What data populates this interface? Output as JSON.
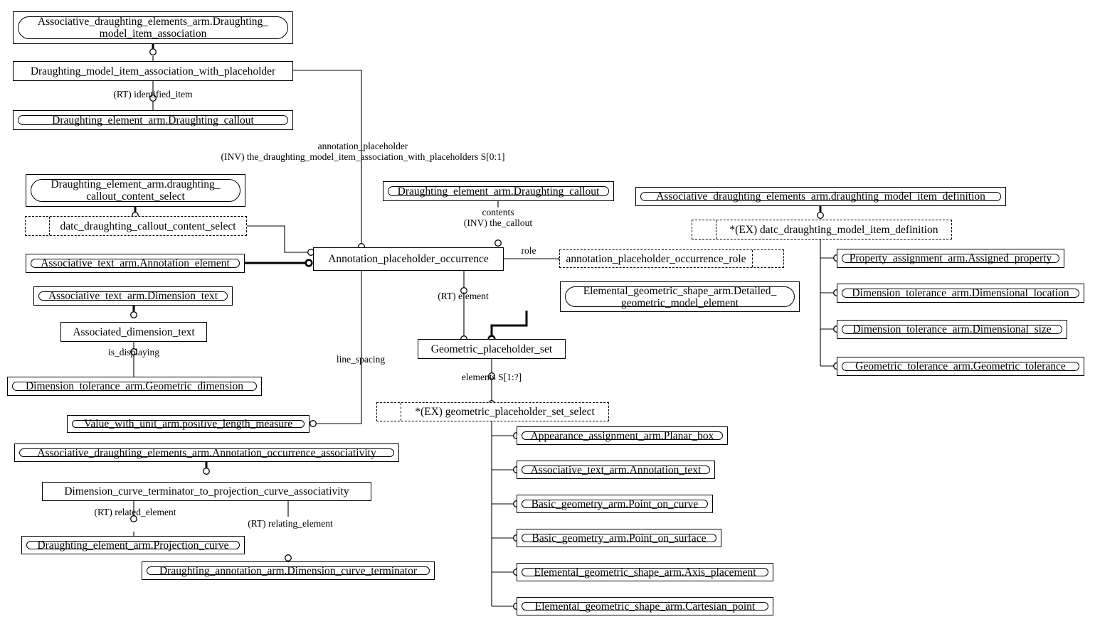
{
  "diagram": {
    "title": "EXPRESS-G entity-relationship diagram",
    "stroke_color": "#000000",
    "background_color": "#ffffff"
  },
  "entities": [
    {
      "id": "e1",
      "label": "Associative_draughting_elements_arm.Draughting_\nmodel_item_association",
      "style": "rounded"
    },
    {
      "id": "e2",
      "label": "Draughting_model_item_association_with_placeholder",
      "style": "plain"
    },
    {
      "id": "e3",
      "label": "Draughting_element_arm.Draughting_callout",
      "style": "rounded"
    },
    {
      "id": "e4",
      "label": "Draughting_element_arm.draughting_\ncallout_content_select",
      "style": "rounded"
    },
    {
      "id": "e5",
      "label": "Draughting_element_arm.Draughting_callout",
      "style": "rounded"
    },
    {
      "id": "e6",
      "label": "Associative_draughting_elements_arm.draughting_model_item_definition",
      "style": "rounded"
    },
    {
      "id": "e7",
      "label": "Associative_text_arm.Annotation_element",
      "style": "rounded"
    },
    {
      "id": "e8",
      "label": "Annotation_placeholder_occurrence",
      "style": "plain"
    },
    {
      "id": "e9",
      "label": "Property_assignment_arm.Assigned_property",
      "style": "rounded"
    },
    {
      "id": "e10",
      "label": "Associative_text_arm.Dimension_text",
      "style": "rounded"
    },
    {
      "id": "e11",
      "label": "Elemental_geometric_shape_arm.Detailed_\ngeometric_model_element",
      "style": "rounded"
    },
    {
      "id": "e12",
      "label": "Dimension_tolerance_arm.Dimensional_location",
      "style": "rounded"
    },
    {
      "id": "e13",
      "label": "Associated_dimension_text",
      "style": "plain"
    },
    {
      "id": "e14",
      "label": "Dimension_tolerance_arm.Dimensional_size",
      "style": "rounded"
    },
    {
      "id": "e15",
      "label": "Geometric_placeholder_set",
      "style": "plain"
    },
    {
      "id": "e16",
      "label": "Geometric_tolerance_arm.Geometric_tolerance",
      "style": "rounded"
    },
    {
      "id": "e17",
      "label": "Dimension_tolerance_arm.Geometric_dimension",
      "style": "rounded"
    },
    {
      "id": "e18",
      "label": "Value_with_unit_arm.positive_length_measure",
      "style": "rounded"
    },
    {
      "id": "e19",
      "label": "Associative_draughting_elements_arm.Annotation_occurrence_associativity",
      "style": "rounded"
    },
    {
      "id": "e20",
      "label": "Appearance_assignment_arm.Planar_box",
      "style": "rounded"
    },
    {
      "id": "e21",
      "label": "Dimension_curve_terminator_to_projection_curve_associativity",
      "style": "plain"
    },
    {
      "id": "e22",
      "label": "Associative_text_arm.Annotation_text",
      "style": "rounded"
    },
    {
      "id": "e23",
      "label": "Basic_geometry_arm.Point_on_curve",
      "style": "rounded"
    },
    {
      "id": "e24",
      "label": "Draughting_element_arm.Projection_curve",
      "style": "rounded"
    },
    {
      "id": "e25",
      "label": "Basic_geometry_arm.Point_on_surface",
      "style": "rounded"
    },
    {
      "id": "e26",
      "label": "Elemental_geometric_shape_arm.Axis_placement",
      "style": "rounded"
    },
    {
      "id": "e27",
      "label": "Draughting_annotation_arm.Dimension_curve_terminator",
      "style": "rounded"
    },
    {
      "id": "e28",
      "label": "Elemental_geometric_shape_arm.Cartesian_point",
      "style": "rounded"
    }
  ],
  "select_boxes": [
    {
      "id": "s1",
      "label": "datc_draughting_callout_content_select",
      "lead": true,
      "tail": false
    },
    {
      "id": "s2",
      "label": "*(EX) datc_draughting_model_item_definition",
      "lead": true,
      "tail": false
    },
    {
      "id": "s3",
      "label": "annotation_placeholder_occurrence_role",
      "lead": false,
      "tail": true
    },
    {
      "id": "s4",
      "label": "*(EX) geometric_placeholder_set_select",
      "lead": true,
      "tail": false
    }
  ],
  "relationship_labels": [
    {
      "id": "r1",
      "text": "(RT) identified_item"
    },
    {
      "id": "r2",
      "text": "annotation_placeholder\n(INV) the_draughting_model_item_association_with_placeholders S[0:1]"
    },
    {
      "id": "r3",
      "text": "contents\n(INV) the_callout"
    },
    {
      "id": "r4",
      "text": "role"
    },
    {
      "id": "r5",
      "text": "(RT) element"
    },
    {
      "id": "r6",
      "text": "is_displaying"
    },
    {
      "id": "r7",
      "text": "line_spacing"
    },
    {
      "id": "r8",
      "text": "elements S[1:?]"
    },
    {
      "id": "r9",
      "text": "(RT) related_element"
    },
    {
      "id": "r10",
      "text": "(RT) relating_element"
    }
  ]
}
